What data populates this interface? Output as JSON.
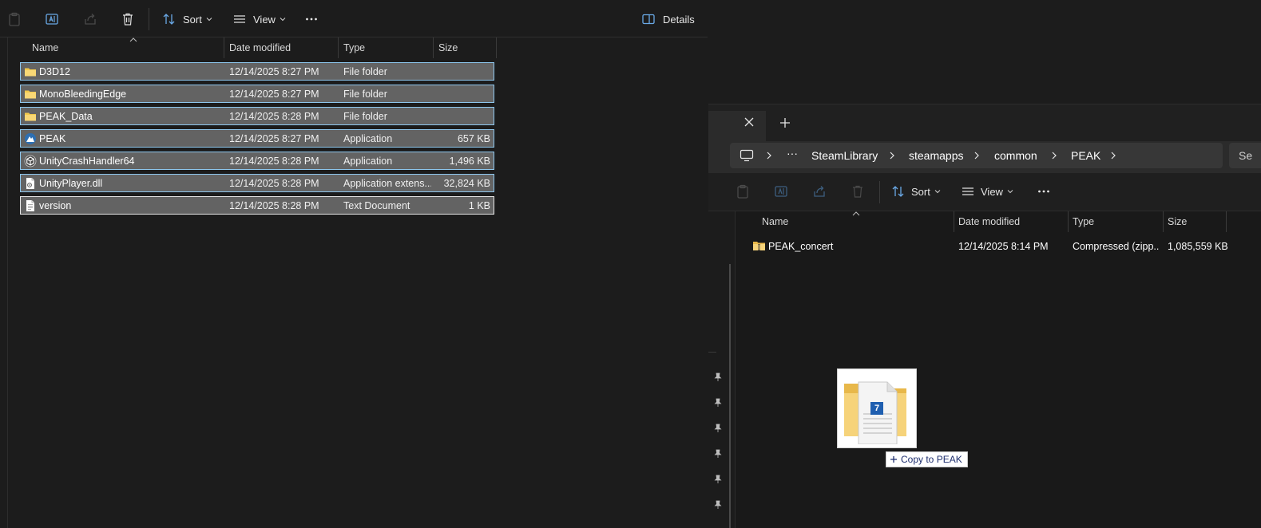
{
  "left": {
    "toolbar": {
      "sort_label": "Sort",
      "view_label": "View",
      "details_label": "Details"
    },
    "columns": [
      "Name",
      "Date modified",
      "Type",
      "Size"
    ],
    "rows": [
      {
        "name": "D3D12",
        "date": "12/14/2025 8:27 PM",
        "type": "File folder",
        "size": "",
        "icon": "folder-icon"
      },
      {
        "name": "MonoBleedingEdge",
        "date": "12/14/2025 8:27 PM",
        "type": "File folder",
        "size": "",
        "icon": "folder-icon"
      },
      {
        "name": "PEAK_Data",
        "date": "12/14/2025 8:28 PM",
        "type": "File folder",
        "size": "",
        "icon": "folder-icon"
      },
      {
        "name": "PEAK",
        "date": "12/14/2025 8:27 PM",
        "type": "Application",
        "size": "657 KB",
        "icon": "app-icon"
      },
      {
        "name": "UnityCrashHandler64",
        "date": "12/14/2025 8:28 PM",
        "type": "Application",
        "size": "1,496 KB",
        "icon": "unity-icon"
      },
      {
        "name": "UnityPlayer.dll",
        "date": "12/14/2025 8:28 PM",
        "type": "Application extens...",
        "size": "32,824 KB",
        "icon": "dll-icon"
      },
      {
        "name": "version",
        "date": "12/14/2025 8:28 PM",
        "type": "Text Document",
        "size": "1 KB",
        "icon": "text-file-icon"
      }
    ]
  },
  "right": {
    "tab_add": "+",
    "breadcrumb": [
      "SteamLibrary",
      "steamapps",
      "common",
      "PEAK"
    ],
    "breadcrumb_more": "···",
    "search_placeholder": "Se",
    "toolbar": {
      "sort_label": "Sort",
      "view_label": "View"
    },
    "columns": [
      "Name",
      "Date modified",
      "Type",
      "Size"
    ],
    "files": [
      {
        "name": "PEAK_concert",
        "date": "12/14/2025 8:14 PM",
        "type": "Compressed (zipp...",
        "size": "1,085,559 KB",
        "icon": "zip-folder-icon"
      }
    ]
  },
  "drag": {
    "badge": "7",
    "tooltip": "Copy to PEAK"
  },
  "colors": {
    "selection_fill": "#636363",
    "selection_border": "#8ec7ee",
    "accent": "#4cc2ff"
  }
}
